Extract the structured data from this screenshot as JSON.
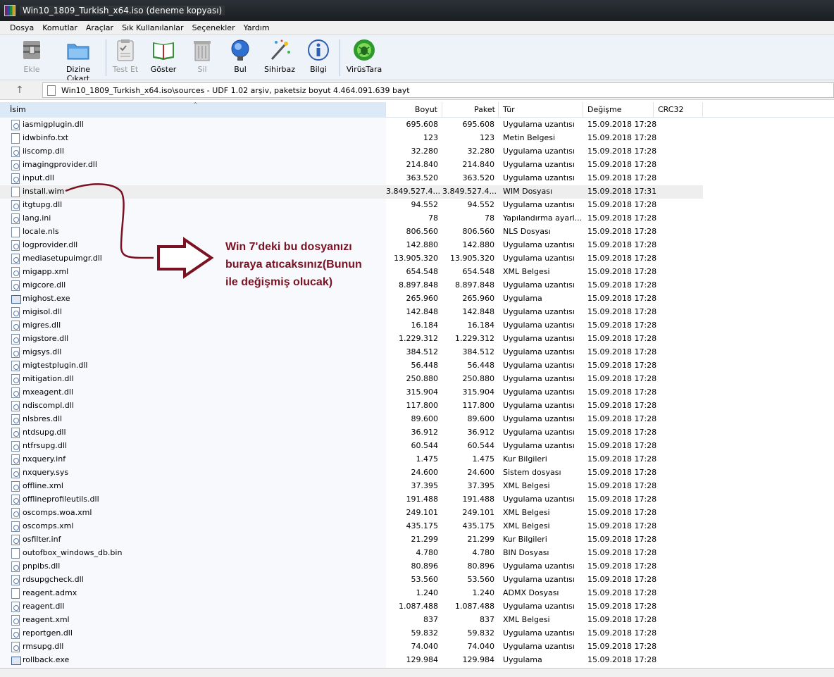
{
  "window": {
    "title": "Win10_1809_Turkish_x64.iso (deneme kopyası)"
  },
  "menu": [
    "Dosya",
    "Komutlar",
    "Araçlar",
    "Sık Kullanılanlar",
    "Seçenekler",
    "Yardım"
  ],
  "toolbar": [
    {
      "label": "Ekle",
      "icon": "archive-add-icon",
      "disabled": true
    },
    {
      "label": "Dizine Çıkart",
      "icon": "folder-extract-icon",
      "disabled": false
    },
    {
      "label": "Test Et",
      "icon": "clipboard-test-icon",
      "disabled": true
    },
    {
      "label": "Göster",
      "icon": "book-view-icon",
      "disabled": false
    },
    {
      "label": "Sil",
      "icon": "trash-icon",
      "disabled": true
    },
    {
      "label": "Bul",
      "icon": "magnifier-icon",
      "disabled": false
    },
    {
      "label": "Sihirbaz",
      "icon": "wizard-wand-icon",
      "disabled": false
    },
    {
      "label": "Bilgi",
      "icon": "info-icon",
      "disabled": false
    },
    {
      "label": "VirüsTara",
      "icon": "virus-scan-icon",
      "disabled": false
    }
  ],
  "address": {
    "path": "Win10_1809_Turkish_x64.iso\\sources - UDF 1.02 arşiv, paketsiz boyut 4.464.091.639 bayt"
  },
  "columns": {
    "name": "İsim",
    "size": "Boyut",
    "packed": "Paket",
    "type": "Tür",
    "modified": "Değişme",
    "crc": "CRC32"
  },
  "files": [
    {
      "name": "iasmigplugin.dll",
      "size": "695.608",
      "packed": "695.608",
      "type": "Uygulama uzantısı",
      "modified": "15.09.2018 17:28",
      "icon": "dll"
    },
    {
      "name": "idwbinfo.txt",
      "size": "123",
      "packed": "123",
      "type": "Metin Belgesi",
      "modified": "15.09.2018 17:28",
      "icon": "plain"
    },
    {
      "name": "iiscomp.dll",
      "size": "32.280",
      "packed": "32.280",
      "type": "Uygulama uzantısı",
      "modified": "15.09.2018 17:28",
      "icon": "dll"
    },
    {
      "name": "imagingprovider.dll",
      "size": "214.840",
      "packed": "214.840",
      "type": "Uygulama uzantısı",
      "modified": "15.09.2018 17:28",
      "icon": "dll"
    },
    {
      "name": "input.dll",
      "size": "363.520",
      "packed": "363.520",
      "type": "Uygulama uzantısı",
      "modified": "15.09.2018 17:28",
      "icon": "dll"
    },
    {
      "name": "install.wim",
      "size": "3.849.527.4...",
      "packed": "3.849.527.4...",
      "type": "WIM Dosyası",
      "modified": "15.09.2018 17:31",
      "icon": "plain",
      "highlight": true
    },
    {
      "name": "itgtupg.dll",
      "size": "94.552",
      "packed": "94.552",
      "type": "Uygulama uzantısı",
      "modified": "15.09.2018 17:28",
      "icon": "dll"
    },
    {
      "name": "lang.ini",
      "size": "78",
      "packed": "78",
      "type": "Yapılandırma ayarl...",
      "modified": "15.09.2018 17:28",
      "icon": "dll"
    },
    {
      "name": "locale.nls",
      "size": "806.560",
      "packed": "806.560",
      "type": "NLS Dosyası",
      "modified": "15.09.2018 17:28",
      "icon": "plain"
    },
    {
      "name": "logprovider.dll",
      "size": "142.880",
      "packed": "142.880",
      "type": "Uygulama uzantısı",
      "modified": "15.09.2018 17:28",
      "icon": "dll"
    },
    {
      "name": "mediasetupuimgr.dll",
      "size": "13.905.320",
      "packed": "13.905.320",
      "type": "Uygulama uzantısı",
      "modified": "15.09.2018 17:28",
      "icon": "dll"
    },
    {
      "name": "migapp.xml",
      "size": "654.548",
      "packed": "654.548",
      "type": "XML Belgesi",
      "modified": "15.09.2018 17:28",
      "icon": "dll"
    },
    {
      "name": "migcore.dll",
      "size": "8.897.848",
      "packed": "8.897.848",
      "type": "Uygulama uzantısı",
      "modified": "15.09.2018 17:28",
      "icon": "dll"
    },
    {
      "name": "mighost.exe",
      "size": "265.960",
      "packed": "265.960",
      "type": "Uygulama",
      "modified": "15.09.2018 17:28",
      "icon": "exe"
    },
    {
      "name": "migisol.dll",
      "size": "142.848",
      "packed": "142.848",
      "type": "Uygulama uzantısı",
      "modified": "15.09.2018 17:28",
      "icon": "dll"
    },
    {
      "name": "migres.dll",
      "size": "16.184",
      "packed": "16.184",
      "type": "Uygulama uzantısı",
      "modified": "15.09.2018 17:28",
      "icon": "dll"
    },
    {
      "name": "migstore.dll",
      "size": "1.229.312",
      "packed": "1.229.312",
      "type": "Uygulama uzantısı",
      "modified": "15.09.2018 17:28",
      "icon": "dll"
    },
    {
      "name": "migsys.dll",
      "size": "384.512",
      "packed": "384.512",
      "type": "Uygulama uzantısı",
      "modified": "15.09.2018 17:28",
      "icon": "dll"
    },
    {
      "name": "migtestplugin.dll",
      "size": "56.448",
      "packed": "56.448",
      "type": "Uygulama uzantısı",
      "modified": "15.09.2018 17:28",
      "icon": "dll"
    },
    {
      "name": "mitigation.dll",
      "size": "250.880",
      "packed": "250.880",
      "type": "Uygulama uzantısı",
      "modified": "15.09.2018 17:28",
      "icon": "dll"
    },
    {
      "name": "mxeagent.dll",
      "size": "315.904",
      "packed": "315.904",
      "type": "Uygulama uzantısı",
      "modified": "15.09.2018 17:28",
      "icon": "dll"
    },
    {
      "name": "ndiscompl.dll",
      "size": "117.800",
      "packed": "117.800",
      "type": "Uygulama uzantısı",
      "modified": "15.09.2018 17:28",
      "icon": "dll"
    },
    {
      "name": "nlsbres.dll",
      "size": "89.600",
      "packed": "89.600",
      "type": "Uygulama uzantısı",
      "modified": "15.09.2018 17:28",
      "icon": "dll"
    },
    {
      "name": "ntdsupg.dll",
      "size": "36.912",
      "packed": "36.912",
      "type": "Uygulama uzantısı",
      "modified": "15.09.2018 17:28",
      "icon": "dll"
    },
    {
      "name": "ntfrsupg.dll",
      "size": "60.544",
      "packed": "60.544",
      "type": "Uygulama uzantısı",
      "modified": "15.09.2018 17:28",
      "icon": "dll"
    },
    {
      "name": "nxquery.inf",
      "size": "1.475",
      "packed": "1.475",
      "type": "Kur Bilgileri",
      "modified": "15.09.2018 17:28",
      "icon": "dll"
    },
    {
      "name": "nxquery.sys",
      "size": "24.600",
      "packed": "24.600",
      "type": "Sistem dosyası",
      "modified": "15.09.2018 17:28",
      "icon": "dll"
    },
    {
      "name": "offline.xml",
      "size": "37.395",
      "packed": "37.395",
      "type": "XML Belgesi",
      "modified": "15.09.2018 17:28",
      "icon": "dll"
    },
    {
      "name": "offlineprofileutils.dll",
      "size": "191.488",
      "packed": "191.488",
      "type": "Uygulama uzantısı",
      "modified": "15.09.2018 17:28",
      "icon": "dll"
    },
    {
      "name": "oscomps.woa.xml",
      "size": "249.101",
      "packed": "249.101",
      "type": "XML Belgesi",
      "modified": "15.09.2018 17:28",
      "icon": "dll"
    },
    {
      "name": "oscomps.xml",
      "size": "435.175",
      "packed": "435.175",
      "type": "XML Belgesi",
      "modified": "15.09.2018 17:28",
      "icon": "dll"
    },
    {
      "name": "osfilter.inf",
      "size": "21.299",
      "packed": "21.299",
      "type": "Kur Bilgileri",
      "modified": "15.09.2018 17:28",
      "icon": "dll"
    },
    {
      "name": "outofbox_windows_db.bin",
      "size": "4.780",
      "packed": "4.780",
      "type": "BIN Dosyası",
      "modified": "15.09.2018 17:28",
      "icon": "plain"
    },
    {
      "name": "pnpibs.dll",
      "size": "80.896",
      "packed": "80.896",
      "type": "Uygulama uzantısı",
      "modified": "15.09.2018 17:28",
      "icon": "dll"
    },
    {
      "name": "rdsupgcheck.dll",
      "size": "53.560",
      "packed": "53.560",
      "type": "Uygulama uzantısı",
      "modified": "15.09.2018 17:28",
      "icon": "dll"
    },
    {
      "name": "reagent.admx",
      "size": "1.240",
      "packed": "1.240",
      "type": "ADMX Dosyası",
      "modified": "15.09.2018 17:28",
      "icon": "plain"
    },
    {
      "name": "reagent.dll",
      "size": "1.087.488",
      "packed": "1.087.488",
      "type": "Uygulama uzantısı",
      "modified": "15.09.2018 17:28",
      "icon": "dll"
    },
    {
      "name": "reagent.xml",
      "size": "837",
      "packed": "837",
      "type": "XML Belgesi",
      "modified": "15.09.2018 17:28",
      "icon": "dll"
    },
    {
      "name": "reportgen.dll",
      "size": "59.832",
      "packed": "59.832",
      "type": "Uygulama uzantısı",
      "modified": "15.09.2018 17:28",
      "icon": "dll"
    },
    {
      "name": "rmsupg.dll",
      "size": "74.040",
      "packed": "74.040",
      "type": "Uygulama uzantısı",
      "modified": "15.09.2018 17:28",
      "icon": "dll"
    },
    {
      "name": "rollback.exe",
      "size": "129.984",
      "packed": "129.984",
      "type": "Uygulama",
      "modified": "15.09.2018 17:28",
      "icon": "exe"
    }
  ],
  "annotation": {
    "lines": [
      "Win 7'deki bu dosyanızı",
      "buraya atıcaksınız(Bunun",
      "ile değişmiş olucak)"
    ],
    "color": "#7a1223"
  }
}
